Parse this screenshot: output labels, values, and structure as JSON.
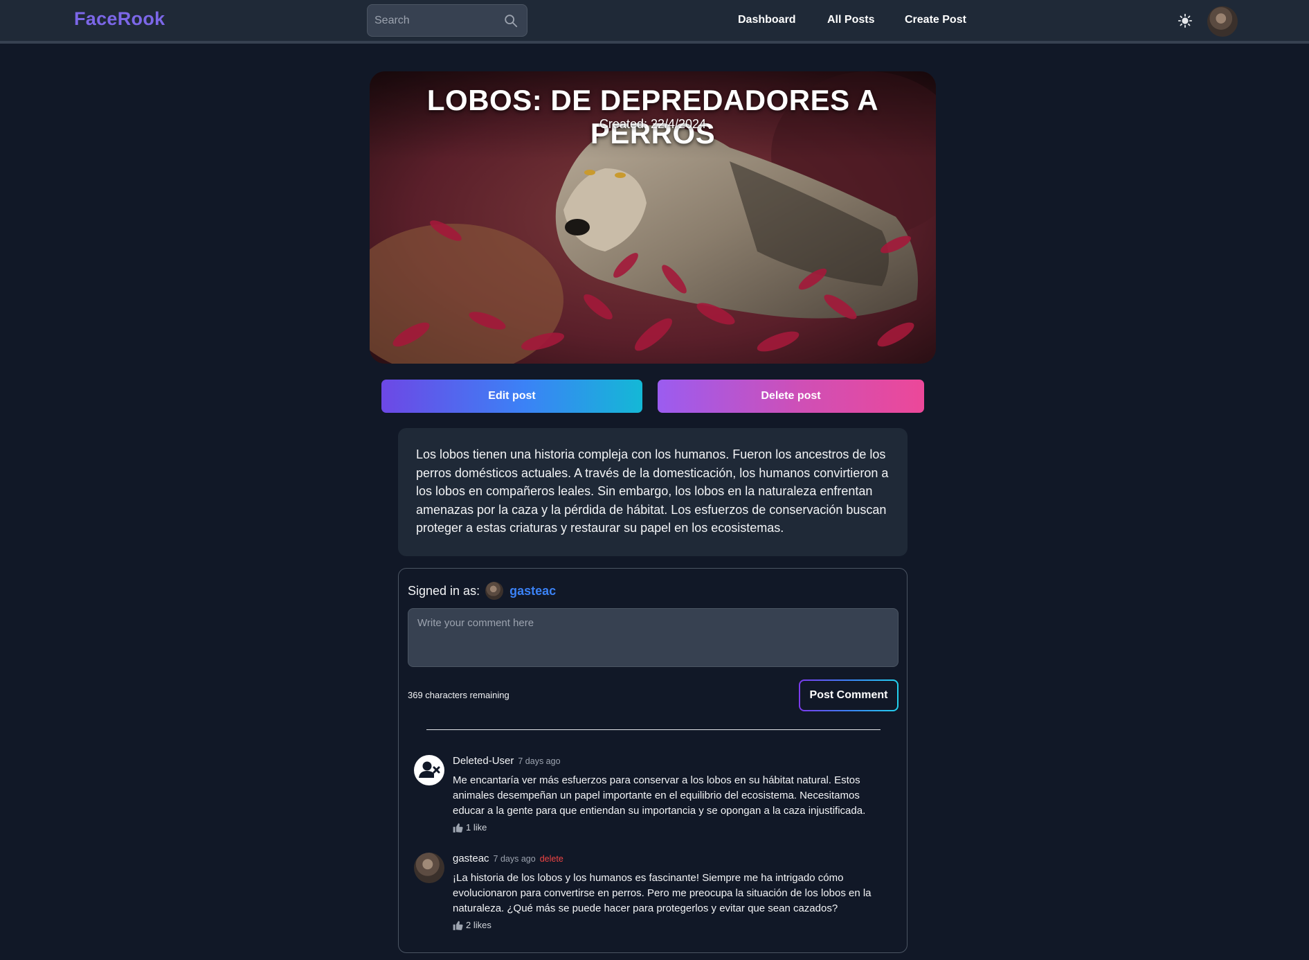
{
  "navbar": {
    "brand": "FaceRook",
    "search_placeholder": "Search",
    "links": [
      "Dashboard",
      "All Posts",
      "Create Post"
    ],
    "theme_icon": "sun-icon"
  },
  "post": {
    "title": "LOBOS: DE DEPREDADORES A PERROS",
    "created": "Created: 22/4/2024",
    "edit_label": "Edit post",
    "delete_label": "Delete post",
    "body": "Los lobos tienen una historia compleja con los humanos. Fueron los ancestros de los perros domésticos actuales. A través de la domesticación, los humanos convirtieron a los lobos en compañeros leales. Sin embargo, los lobos en la naturaleza enfrentan amenazas por la caza y la pérdida de hábitat. Los esfuerzos de conservación buscan proteger a estas criaturas y restaurar su papel en los ecosistemas."
  },
  "comment_form": {
    "signed_in_label": "Signed in as:",
    "username": "gasteac",
    "placeholder": "Write your comment here",
    "chars_remaining": "369 characters remaining",
    "post_label": "Post Comment"
  },
  "comments": [
    {
      "author": "Deleted-User",
      "time": "7 days ago",
      "text": "Me encantaría ver más esfuerzos para conservar a los lobos en su hábitat natural. Estos animales desempeñan un papel importante en el equilibrio del ecosistema. Necesitamos educar a la gente para que entiendan su importancia y se opongan a la caza injustificada.",
      "likes": "1 like"
    },
    {
      "author": "gasteac",
      "time": "7 days ago",
      "delete_label": "delete",
      "text": "¡La historia de los lobos y los humanos es fascinante! Siempre me ha intrigado cómo evolucionaron para convertirse en perros. Pero me preocupa la situación de los lobos en la naturaleza. ¿Qué más se puede hacer para protegerlos y evitar que sean cazados?",
      "likes": "2 likes"
    }
  ],
  "colors": {
    "background": "#111827",
    "navbar": "#1f2937",
    "brand": "#7c67e8",
    "link_blue": "#3b82f6",
    "danger": "#ef4444"
  }
}
